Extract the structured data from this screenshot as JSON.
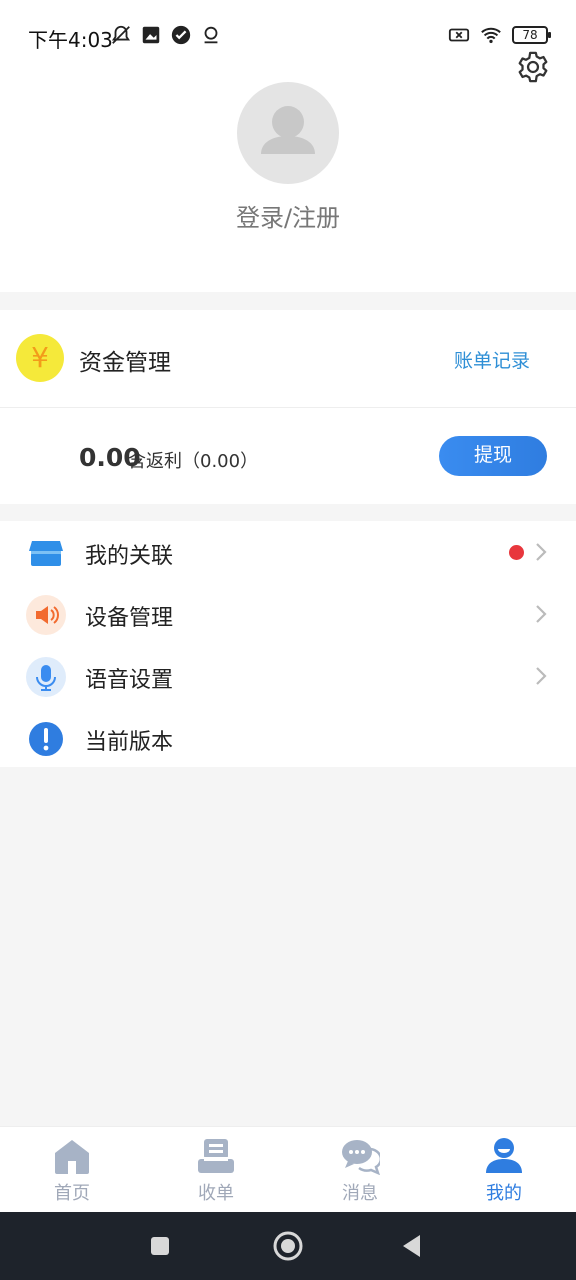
{
  "status": {
    "time": "下午4:03",
    "battery": "78"
  },
  "profile": {
    "login_text": "登录/注册"
  },
  "funds": {
    "title": "资金管理",
    "bill_link": "账单记录",
    "balance": "0.00",
    "rebate": "含返利（0.00）",
    "withdraw": "提现"
  },
  "menu": [
    {
      "label": "我的关联",
      "icon": "store-icon",
      "badge": true,
      "chevron": true
    },
    {
      "label": "设备管理",
      "icon": "speaker-icon",
      "badge": false,
      "chevron": true
    },
    {
      "label": "语音设置",
      "icon": "microphone-icon",
      "badge": false,
      "chevron": true
    },
    {
      "label": "当前版本",
      "icon": "info-icon",
      "badge": false,
      "chevron": false
    }
  ],
  "tabs": [
    {
      "label": "首页",
      "icon": "home-icon",
      "active": false
    },
    {
      "label": "收单",
      "icon": "register-icon",
      "active": false
    },
    {
      "label": "消息",
      "icon": "chat-icon",
      "active": false
    },
    {
      "label": "我的",
      "icon": "user-icon",
      "active": true
    }
  ],
  "colors": {
    "accent": "#2f7de0",
    "badge": "#e8373d",
    "yen_bg": "#f5e93a",
    "navbar": "#1e232b"
  }
}
